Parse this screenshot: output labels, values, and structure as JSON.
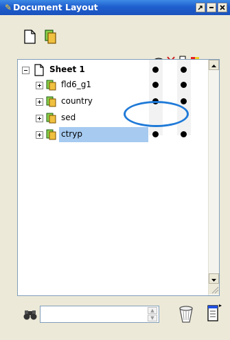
{
  "window": {
    "title": "Document Layout"
  },
  "title_buttons": [
    {
      "name": "restore",
      "glyph": "↗"
    },
    {
      "name": "minimize",
      "glyph": "–"
    },
    {
      "name": "close",
      "glyph": "✕"
    }
  ],
  "toolbar": {
    "new_sheet_icon": "new-document-icon",
    "new_layer_icon": "layers-icon",
    "attributes": [
      "visibility-eye-icon",
      "scissors-icon",
      "printer-icon",
      "color-icon"
    ]
  },
  "tree": {
    "sheet": {
      "label": "Sheet 1",
      "expanded": true
    },
    "layers": [
      {
        "label": "fld6_g1",
        "selected": false
      },
      {
        "label": "country",
        "selected": false
      },
      {
        "label": "sed",
        "selected": false
      },
      {
        "label": "ctryp",
        "selected": true
      }
    ]
  },
  "find": {
    "placeholder": "",
    "value": ""
  },
  "colors": {
    "title_bar": "#2562d1",
    "selection": "#a6caf0",
    "ellipse": "#1f7ad8"
  }
}
